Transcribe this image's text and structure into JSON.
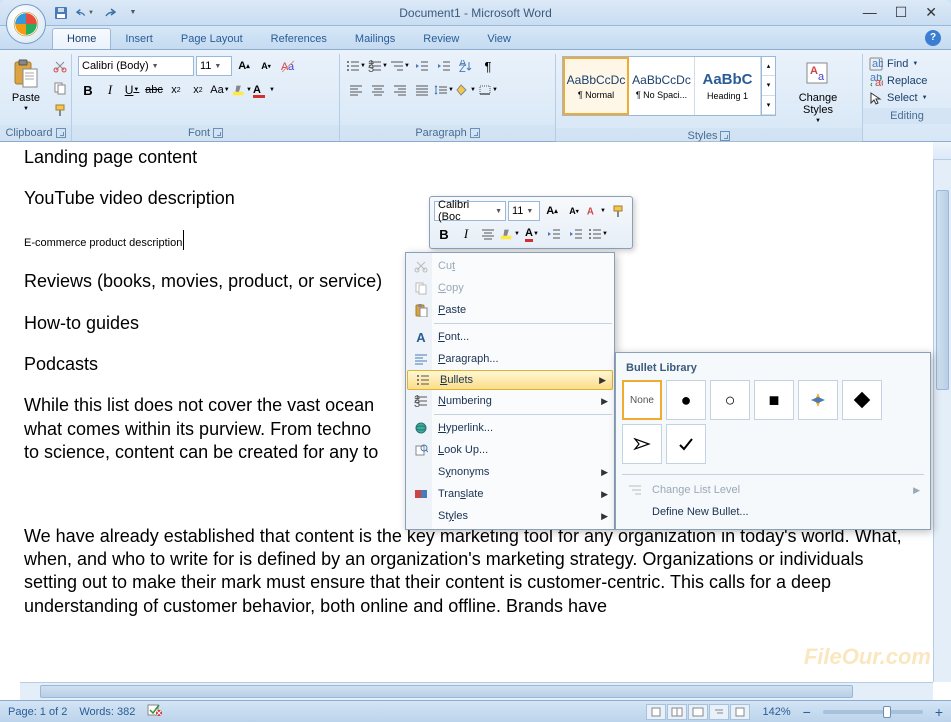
{
  "title": "Document1 - Microsoft Word",
  "qat": {
    "save": "save-icon",
    "undo": "undo-icon",
    "redo": "redo-icon"
  },
  "tabs": [
    "Home",
    "Insert",
    "Page Layout",
    "References",
    "Mailings",
    "Review",
    "View"
  ],
  "ribbon": {
    "clipboard": {
      "label": "Clipboard",
      "paste": "Paste"
    },
    "font": {
      "label": "Font",
      "family": "Calibri (Body)",
      "size": "11"
    },
    "paragraph": {
      "label": "Paragraph"
    },
    "styles": {
      "label": "Styles",
      "items": [
        {
          "preview": "AaBbCcDc",
          "name": "¶ Normal"
        },
        {
          "preview": "AaBbCcDc",
          "name": "¶ No Spaci..."
        },
        {
          "preview": "AaBbC",
          "name": "Heading 1"
        }
      ],
      "change": "Change Styles"
    },
    "editing": {
      "label": "Editing",
      "find": "Find",
      "replace": "Replace",
      "select": "Select"
    }
  },
  "document": {
    "lines": [
      "Landing page content",
      "YouTube video description",
      "E-commerce product description",
      "Reviews (books, movies, product, or service)",
      "How-to guides",
      "Podcasts"
    ],
    "para1": "While this list does not cover the vast ocean                                                                                                                                           d what comes within its purview. From technology to food to fashion to automobiles to travel to science, content can be created for any topic.",
    "para2": "We have already established that content is the key marketing tool for any organization in today's world. What, when, and who to write for is defined by an organization's marketing strategy. Organizations or individuals setting out to make their mark must ensure that their content is customer-centric. This calls for a deep understanding of customer behavior, both online and offline. Brands have"
  },
  "mini": {
    "font": "Calibri (Boc",
    "size": "11"
  },
  "context_menu": [
    {
      "label": "Cut",
      "key": "t",
      "icon": "cut",
      "disabled": true
    },
    {
      "label": "Copy",
      "key": "C",
      "icon": "copy",
      "disabled": true
    },
    {
      "label": "Paste",
      "key": "P",
      "icon": "paste",
      "disabled": false
    },
    {
      "label": "Font...",
      "key": "F",
      "icon": "font",
      "disabled": false
    },
    {
      "label": "Paragraph...",
      "key": "P",
      "icon": "paragraph",
      "disabled": false
    },
    {
      "label": "Bullets",
      "key": "B",
      "icon": "bullets",
      "arrow": true,
      "hover": true
    },
    {
      "label": "Numbering",
      "key": "N",
      "icon": "numbering",
      "arrow": true
    },
    {
      "label": "Hyperlink...",
      "key": "H",
      "icon": "hyperlink"
    },
    {
      "label": "Look Up...",
      "key": "L",
      "icon": "lookup"
    },
    {
      "label": "Synonyms",
      "key": "S",
      "icon": "synonyms",
      "arrow": true
    },
    {
      "label": "Translate",
      "key": "T",
      "icon": "translate",
      "arrow": true
    },
    {
      "label": "Styles",
      "key": "S",
      "icon": "styles",
      "arrow": true
    }
  ],
  "bullet_gallery": {
    "header": "Bullet Library",
    "none": "None",
    "change_level": "Change List Level",
    "define": "Define New Bullet..."
  },
  "status": {
    "page": "Page: 1 of 2",
    "words": "Words: 382",
    "zoom": "142%"
  },
  "watermark": "FileOur.com"
}
